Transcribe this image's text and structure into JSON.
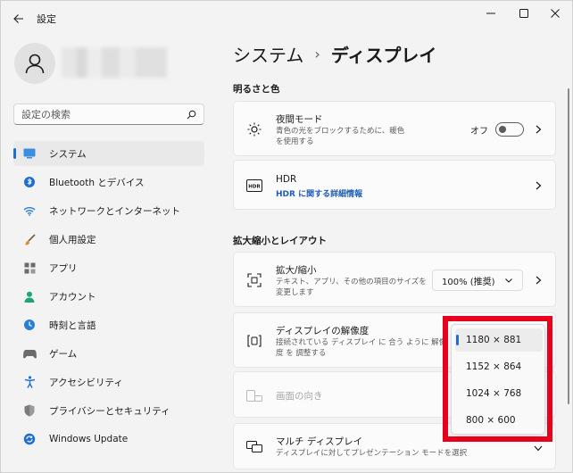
{
  "window": {
    "title": "設定",
    "controls": {
      "minimize_icon": "minimize-icon",
      "maximize_icon": "maximize-icon",
      "close_icon": "close-icon"
    }
  },
  "sidebar": {
    "search_placeholder": "設定の検索",
    "items": [
      {
        "label": "システム",
        "icon": "system-display-icon",
        "active": true
      },
      {
        "label": "Bluetooth とデバイス",
        "icon": "bluetooth-icon"
      },
      {
        "label": "ネットワークとインターネット",
        "icon": "wifi-icon"
      },
      {
        "label": "個人用設定",
        "icon": "brush-icon"
      },
      {
        "label": "アプリ",
        "icon": "apps-icon"
      },
      {
        "label": "アカウント",
        "icon": "account-icon"
      },
      {
        "label": "時刻と言語",
        "icon": "time-language-icon"
      },
      {
        "label": "ゲーム",
        "icon": "gamepad-icon"
      },
      {
        "label": "アクセシビリティ",
        "icon": "accessibility-icon"
      },
      {
        "label": "プライバシーとセキュリティ",
        "icon": "shield-icon"
      },
      {
        "label": "Windows Update",
        "icon": "windows-update-icon"
      }
    ]
  },
  "main": {
    "breadcrumb_parent": "システム",
    "breadcrumb_separator": "›",
    "breadcrumb_current": "ディスプレイ",
    "section_brightness": "明るさと色",
    "night_light": {
      "title": "夜間モード",
      "desc_line1": "青色の光をブロックするために、暖色",
      "desc_line2": "を使用する",
      "toggle_label": "オフ",
      "toggle_on": false
    },
    "hdr": {
      "title": "HDR",
      "link": "HDR に関する詳細情報"
    },
    "section_scale": "拡大縮小とレイアウト",
    "scale": {
      "title": "拡大/縮小",
      "desc_line1": "テキスト、アプリ、その他の項目のサイズを",
      "desc_line2": "変更します",
      "value": "100% (推奨)"
    },
    "resolution": {
      "title": "ディスプレイの解像度",
      "desc_line1": "接続されている ディスプレイ に 合う ように 解像",
      "desc_line2": "度 を 調整する",
      "options": [
        "1180 × 881",
        "1152 × 864",
        "1024 × 768",
        "800 × 600"
      ],
      "selected": "1180 × 881"
    },
    "orientation": {
      "title": "画面の向き"
    },
    "multi_display": {
      "title": "マルチ ディスプレイ",
      "desc": "ディスプレイに対してプレゼンテーション モードを選択"
    }
  },
  "colors": {
    "accent": "#1f6fd0",
    "highlight": "#e8001c",
    "link": "#1f5db8"
  }
}
